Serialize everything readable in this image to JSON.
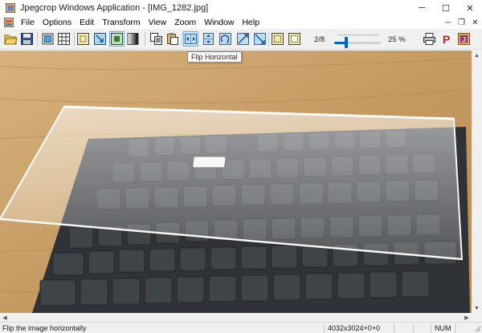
{
  "window": {
    "title": "Jpegcrop Windows Application - [IMG_1282.jpg]",
    "minimize_glyph": "─",
    "maximize_glyph": "☐",
    "close_glyph": "✕"
  },
  "menu": {
    "items": [
      "File",
      "Options",
      "Edit",
      "Transform",
      "View",
      "Zoom",
      "Window",
      "Help"
    ],
    "mdi_minimize_glyph": "─",
    "mdi_restore_glyph": "❐",
    "mdi_close_glyph": "✕"
  },
  "toolbar": {
    "page_indicator": "2/8",
    "zoom_text": "25 %",
    "zoom_percent": 25,
    "buttons": [
      {
        "name": "open-icon"
      },
      {
        "name": "save-icon"
      },
      {
        "name": "crop-select-icon"
      },
      {
        "name": "grid-icon"
      },
      {
        "name": "crop-frame-icon"
      },
      {
        "name": "crop-corner-icon"
      },
      {
        "name": "crop-center-icon"
      },
      {
        "name": "grayscale-icon"
      },
      {
        "name": "copy-icon"
      },
      {
        "name": "paste-icon"
      },
      {
        "name": "flip-horizontal-icon"
      },
      {
        "name": "flip-vertical-icon"
      },
      {
        "name": "rotate-icon"
      },
      {
        "name": "transpose-icon"
      },
      {
        "name": "transverse-icon"
      },
      {
        "name": "select-all-icon"
      },
      {
        "name": "deselect-icon"
      },
      {
        "name": "print-icon"
      },
      {
        "name": "properties-icon"
      },
      {
        "name": "jpeg-icon"
      }
    ],
    "properties_letter": "P",
    "jpeg_letter": "J"
  },
  "tooltip": {
    "text": "Flip Horizontal"
  },
  "statusbar": {
    "message": "Flip the image horizontally",
    "dimensions": "4032x3024+0+0",
    "num_lock": "NUM"
  },
  "colors": {
    "accent": "#0067c0",
    "toolbar_bg": "#f0f0f0",
    "desk_wood": "#c9a06a"
  }
}
